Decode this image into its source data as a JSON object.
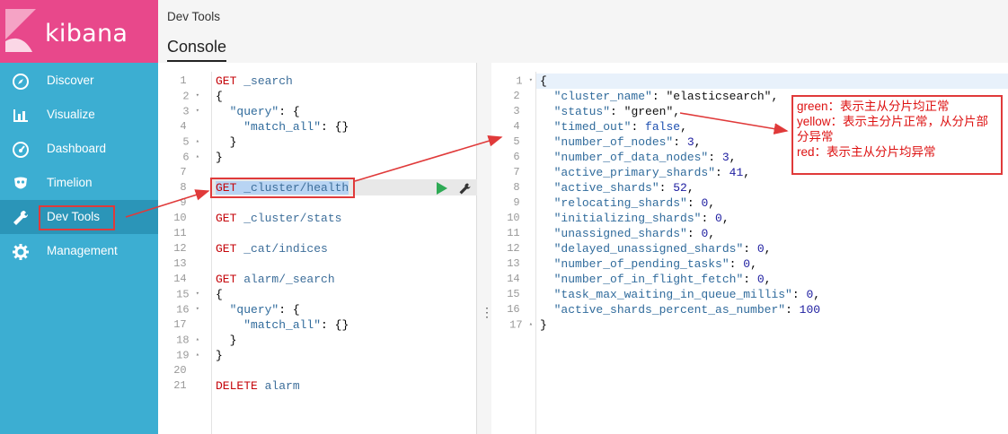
{
  "brand": {
    "name": "kibana",
    "colors": {
      "logo_bg": "#e8488b",
      "sidebar_bg": "#3caed2",
      "active_bg": "#2b95b8",
      "annotation": "#e03a3a"
    }
  },
  "nav": [
    {
      "label": "Discover",
      "icon": "compass-icon"
    },
    {
      "label": "Visualize",
      "icon": "bar-chart-icon"
    },
    {
      "label": "Dashboard",
      "icon": "gauge-icon"
    },
    {
      "label": "Timelion",
      "icon": "mask-icon"
    },
    {
      "label": "Dev Tools",
      "icon": "wrench-icon",
      "active": true
    },
    {
      "label": "Management",
      "icon": "gear-icon"
    }
  ],
  "header": {
    "breadcrumb": "Dev Tools",
    "tab": "Console"
  },
  "request_lines": [
    "GET _search",
    "{",
    "  \"query\": {",
    "    \"match_all\": {}",
    "  }",
    "}",
    "",
    "GET _cluster/health",
    "",
    "GET _cluster/stats",
    "",
    "GET _cat/indices",
    "",
    "GET alarm/_search",
    "{",
    "  \"query\": {",
    "    \"match_all\": {}",
    "  }",
    "}",
    "",
    "DELETE alarm"
  ],
  "response_lines": [
    "{",
    "  \"cluster_name\": \"elasticsearch\",",
    "  \"status\": \"green\",",
    "  \"timed_out\": false,",
    "  \"number_of_nodes\": 3,",
    "  \"number_of_data_nodes\": 3,",
    "  \"active_primary_shards\": 41,",
    "  \"active_shards\": 52,",
    "  \"relocating_shards\": 0,",
    "  \"initializing_shards\": 0,",
    "  \"unassigned_shards\": 0,",
    "  \"delayed_unassigned_shards\": 0,",
    "  \"number_of_pending_tasks\": 0,",
    "  \"number_of_in_flight_fetch\": 0,",
    "  \"task_max_waiting_in_queue_millis\": 0,",
    "  \"active_shards_percent_as_number\": 100",
    "}"
  ],
  "annotation": {
    "green": "green：表示主从分片均正常",
    "yellow": "yellow：表示主分片正常，从分片部分异常",
    "red": "red：表示主从分片均异常"
  }
}
